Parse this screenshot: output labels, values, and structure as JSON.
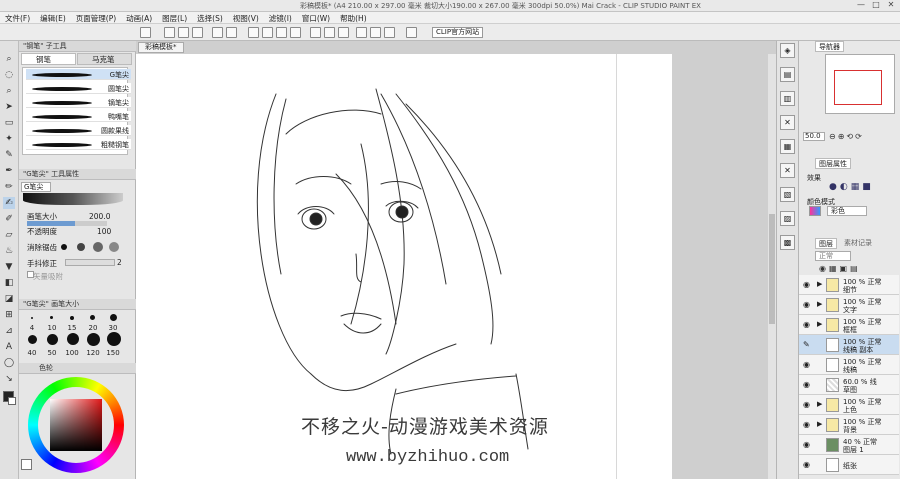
{
  "titlebar": {
    "title": "彩稿模板* (A4 210.00 x 297.00 毫米 裁切大小190.00 x 267.00 毫米 300dpi 50.0%)   Mai Crack - CLIP STUDIO PAINT EX",
    "minimize": "—",
    "maximize": "□",
    "close": "✕"
  },
  "menu": [
    "文件(F)",
    "编辑(E)",
    "页面管理(P)",
    "动画(A)",
    "图层(L)",
    "选择(S)",
    "视图(V)",
    "滤镜(I)",
    "窗口(W)",
    "帮助(H)"
  ],
  "toolbar": {
    "clip_button": "CLIP官方网站"
  },
  "subtool_panel": {
    "header": "\"钢笔\" 子工具",
    "tabs": [
      "钢笔",
      "马克笔"
    ],
    "brushes": [
      "G笔尖",
      "圆笔尖",
      "镝笔尖",
      "鸭嘴笔",
      "圆款果线",
      "粗糙钢笔"
    ]
  },
  "tool_property": {
    "header": "\"G笔尖\" 工具属性",
    "current": "G笔尖",
    "brush_size_label": "画笔大小",
    "brush_size_value": "200.0",
    "opacity_label": "不透明度",
    "opacity_value": "100",
    "antialias_label": "消除锯齿",
    "stabilizer_label": "手抖修正",
    "stabilizer_value": "2",
    "vector_label": "矢量吸附"
  },
  "brush_size_panel": {
    "header": "\"G笔尖\" 画笔大小",
    "sizes": [
      "4",
      "10",
      "15",
      "20",
      "30",
      "40",
      "50",
      "100",
      "120",
      "150"
    ]
  },
  "color_panel": {
    "tab": "色轮"
  },
  "canvas": {
    "tab": "彩稿模板*",
    "watermark_line1": "不移之火-动漫游戏美术资源",
    "watermark_line2": "www.byzhihuo.com"
  },
  "navigator": {
    "tab": "导航器",
    "zoom": "50.0"
  },
  "layer_property": {
    "tab": "图层属性",
    "effect_label": "效果",
    "color_mode_label": "颜色模式",
    "color_mode_value": "彩色"
  },
  "layers": {
    "tabs": [
      "图层",
      "素材记录"
    ],
    "blend_mode": "正常",
    "items": [
      {
        "name": "细节",
        "opacity": "100 % 正常",
        "folder": true
      },
      {
        "name": "文字",
        "opacity": "100 % 正常",
        "folder": true
      },
      {
        "name": "框框",
        "opacity": "100 % 正常",
        "folder": true
      },
      {
        "name": "线稿 副本",
        "opacity": "100 % 正常",
        "folder": false,
        "selected": true
      },
      {
        "name": "线稿",
        "opacity": "100 % 正常",
        "folder": false
      },
      {
        "name": "草图",
        "opacity": "60.0 % 线",
        "folder": false
      },
      {
        "name": "上色",
        "opacity": "100 % 正常",
        "folder": true
      },
      {
        "name": "背景",
        "opacity": "100 % 正常",
        "folder": true
      },
      {
        "name": "图层 1",
        "opacity": "40 % 正常",
        "folder": false,
        "green": true
      },
      {
        "name": "纸张",
        "opacity": "",
        "folder": false
      }
    ]
  }
}
